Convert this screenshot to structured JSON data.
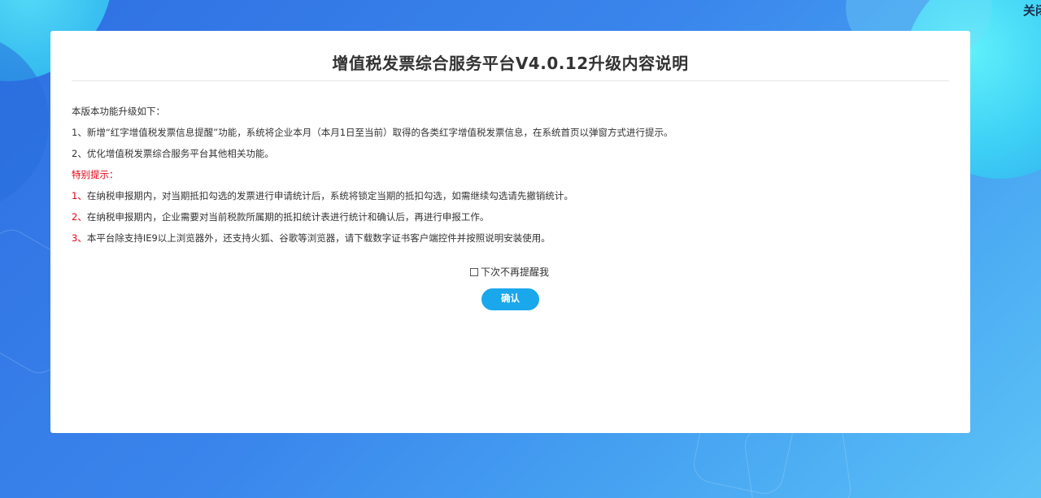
{
  "close_label": "关闭",
  "dialog": {
    "title": "增值税发票综合服务平台V4.0.12升级内容说明",
    "intro": "本版本功能升级如下：",
    "upgrades": [
      "1、新增“红字增值税发票信息提醒”功能，系统将企业本月（本月1日至当前）取得的各类红字增值税发票信息，在系统首页以弹窗方式进行提示。",
      "2、优化增值税发票综合服务平台其他相关功能。"
    ],
    "notice_heading": "特别提示：",
    "notices": [
      {
        "num": "1、",
        "text": "在纳税申报期内，对当期抵扣勾选的发票进行申请统计后，系统将锁定当期的抵扣勾选，如需继续勾选请先撤销统计。"
      },
      {
        "num": "2、",
        "text": "在纳税申报期内，企业需要对当前税款所属期的抵扣统计表进行统计和确认后，再进行申报工作。"
      },
      {
        "num": "3、",
        "text": "本平台除支持IE9以上浏览器外，还支持火狐、谷歌等浏览器，请下载数字证书客户端控件并按照说明安装使用。"
      }
    ],
    "remember_label": "下次不再提醒我",
    "remember_checked": false,
    "confirm_label": "确认"
  },
  "colors": {
    "accent": "#1aa7ec",
    "warning": "#e60012",
    "text": "#333333"
  }
}
